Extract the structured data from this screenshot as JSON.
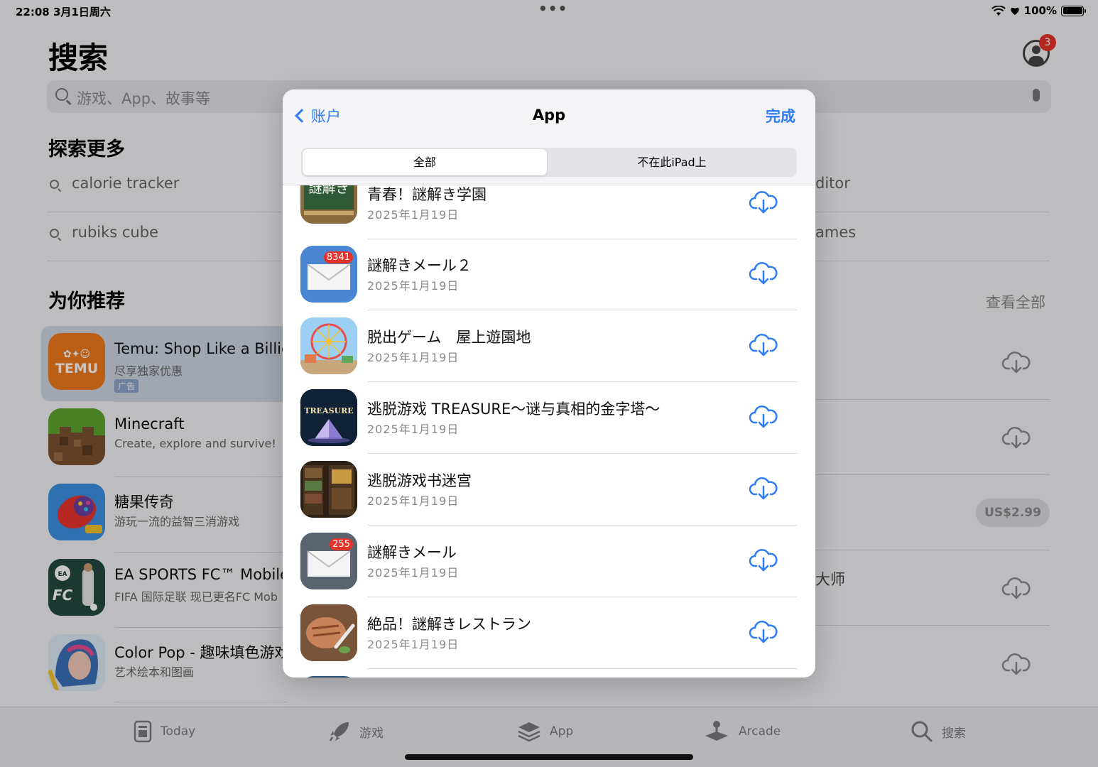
{
  "status": {
    "time": "22:08",
    "date": "3月1日周六",
    "battery": "100%",
    "dots": "•••"
  },
  "page": {
    "title": "搜索",
    "notification_count": "3"
  },
  "search": {
    "placeholder": "游戏、App、故事等"
  },
  "explore": {
    "title": "探索更多",
    "items": [
      "calorie tracker",
      "rubiks cube"
    ],
    "right_items": [
      "ditor",
      "ames"
    ]
  },
  "recommend": {
    "title": "为你推荐",
    "see_all": "查看全部",
    "apps": [
      {
        "name": "Temu: Shop Like a Billion",
        "sub": "尽享独家优惠",
        "ad": "广告",
        "icon": "temu-icon"
      },
      {
        "name": "Minecraft",
        "sub": "Create, explore and survive!",
        "icon": "minecraft-icon"
      },
      {
        "name": "糖果传奇",
        "sub": "游玩一流的益智三消游戏",
        "icon": "candy-crush-icon"
      },
      {
        "name": "EA SPORTS FC™ Mobile",
        "sub": "FIFA 国际足联 现已更名FC Mob",
        "icon": "ea-fc-icon"
      },
      {
        "name": "Color Pop - 趣味填色游戏",
        "sub": "艺术绘本和图画",
        "icon": "color-pop-icon"
      }
    ],
    "price": "US$2.99",
    "right_text": "大师"
  },
  "tabs": [
    {
      "label": "Today",
      "icon": "today-icon"
    },
    {
      "label": "游戏",
      "icon": "rocket-icon"
    },
    {
      "label": "App",
      "icon": "layers-icon"
    },
    {
      "label": "Arcade",
      "icon": "joystick-icon"
    },
    {
      "label": "搜索",
      "icon": "search-icon"
    }
  ],
  "modal": {
    "back_label": "账户",
    "title": "App",
    "done_label": "完成",
    "segments": [
      "全部",
      "不在此iPad上"
    ],
    "apps": [
      {
        "name": "青春！謎解き学園",
        "date": "2025年1月19日"
      },
      {
        "name": "謎解きメール２",
        "date": "2025年1月19日",
        "badge": "8341"
      },
      {
        "name": "脱出ゲーム　屋上遊園地",
        "date": "2025年1月19日"
      },
      {
        "name": "逃脱游戏 TREASURE～谜与真相的金字塔～",
        "date": "2025年1月19日"
      },
      {
        "name": "逃脱游戏书迷宫",
        "date": "2025年1月19日"
      },
      {
        "name": "謎解きメール",
        "date": "2025年1月19日",
        "badge": "255"
      },
      {
        "name": "絶品！謎解きレストラン",
        "date": "2025年1月19日"
      }
    ],
    "icon_texts": {
      "chalk": "謎解き",
      "treasure": "TREASURE"
    }
  },
  "colors": {
    "accent": "#2f7df6",
    "badge": "#e5332a"
  }
}
